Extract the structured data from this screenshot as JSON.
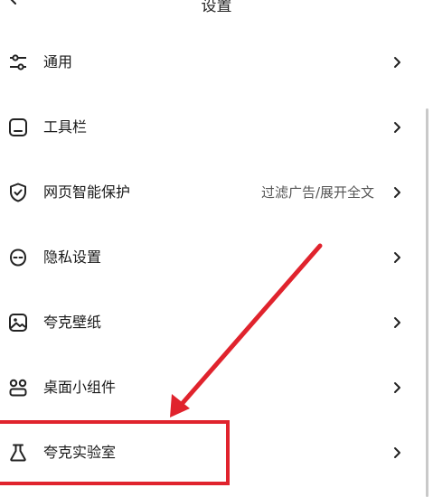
{
  "header": {
    "title": "设置"
  },
  "settings": {
    "items": [
      {
        "label": "通用",
        "value": "",
        "icon": "sliders-icon"
      },
      {
        "label": "工具栏",
        "value": "",
        "icon": "toolbar-icon"
      },
      {
        "label": "网页智能保护",
        "value": "过滤广告/展开全文",
        "icon": "shield-check-icon"
      },
      {
        "label": "隐私设置",
        "value": "",
        "icon": "privacy-mask-icon"
      },
      {
        "label": "夸克壁纸",
        "value": "",
        "icon": "wallpaper-icon"
      },
      {
        "label": "桌面小组件",
        "value": "",
        "icon": "widgets-icon"
      },
      {
        "label": "夸克实验室",
        "value": "",
        "icon": "flask-icon"
      }
    ]
  },
  "colors": {
    "annotation_red": "#e0232d",
    "text": "#1a1a1a",
    "secondary_text": "#555555"
  }
}
